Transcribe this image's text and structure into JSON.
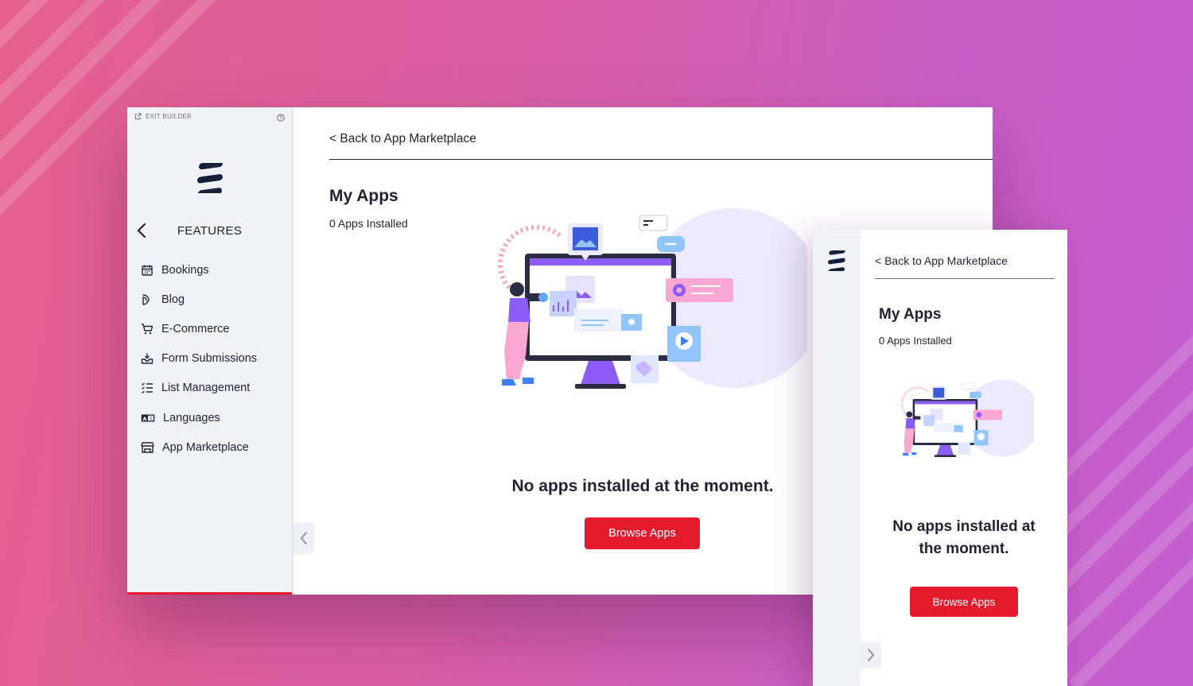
{
  "colors": {
    "accent": "#e51b2d",
    "text": "#1f2332",
    "sidebar_bg": "#f1f2f6",
    "illustration_purple": "#8b5cf6"
  },
  "builder": {
    "exit_label": "EXIT BUILDER",
    "help_icon": "help-icon"
  },
  "sidebar": {
    "section_title": "FEATURES",
    "items": [
      {
        "label": "Bookings",
        "icon": "calendar-icon"
      },
      {
        "label": "Blog",
        "icon": "blog-icon"
      },
      {
        "label": "E-Commerce",
        "icon": "cart-icon"
      },
      {
        "label": "Form Submissions",
        "icon": "inbox-icon"
      },
      {
        "label": "List Management",
        "icon": "checklist-icon"
      },
      {
        "label": "Languages",
        "icon": "language-icon"
      },
      {
        "label": "App Marketplace",
        "icon": "store-icon"
      }
    ]
  },
  "main": {
    "back_link": "< Back to App Marketplace",
    "title": "My Apps",
    "installed_count": "0 Apps Installed",
    "empty_message": "No apps installed at the moment.",
    "browse_button": "Browse Apps"
  },
  "mobile": {
    "back_link": "< Back to App Marketplace",
    "title": "My Apps",
    "installed_count": "0 Apps Installed",
    "empty_message": "No apps installed at the moment.",
    "browse_button": "Browse Apps"
  }
}
